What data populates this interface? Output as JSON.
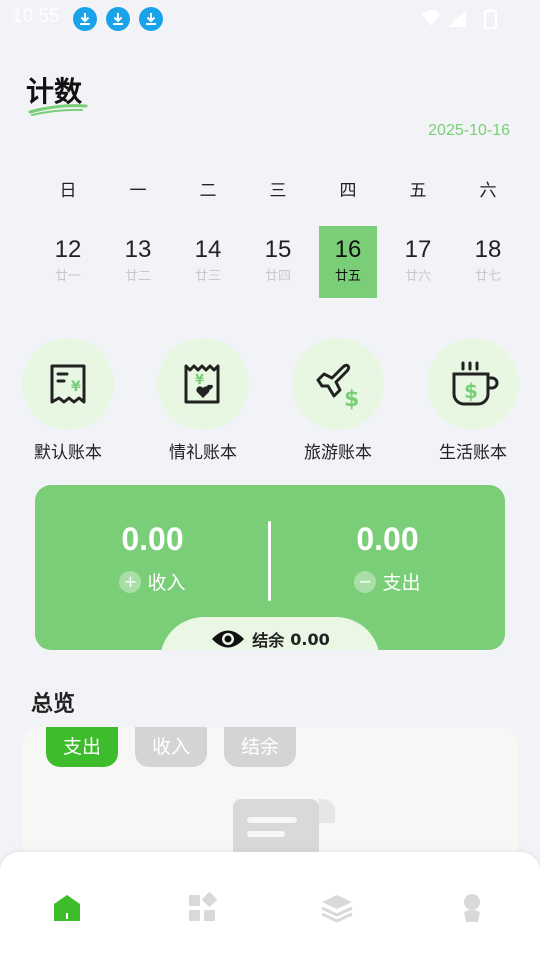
{
  "status_bar": {
    "time": "10:55",
    "notification_icons": [
      "download-icon",
      "download-icon",
      "download-icon"
    ],
    "system_icons": [
      "wifi-icon",
      "signal-icon",
      "battery-icon"
    ]
  },
  "header": {
    "title": "计数",
    "date": "2025-10-16"
  },
  "calendar": {
    "weekdays": [
      "日",
      "一",
      "二",
      "三",
      "四",
      "五",
      "六"
    ],
    "days": [
      {
        "num": "12",
        "lunar": "廿一"
      },
      {
        "num": "13",
        "lunar": "廿二"
      },
      {
        "num": "14",
        "lunar": "廿三"
      },
      {
        "num": "15",
        "lunar": "廿四"
      },
      {
        "num": "16",
        "lunar": "廿五"
      },
      {
        "num": "17",
        "lunar": "廿六"
      },
      {
        "num": "18",
        "lunar": "廿七"
      }
    ],
    "selected_index": 4
  },
  "books": [
    {
      "label": "默认账本",
      "icon": "receipt-yen-icon"
    },
    {
      "label": "情礼账本",
      "icon": "gift-receipt-icon"
    },
    {
      "label": "旅游账本",
      "icon": "plane-dollar-icon"
    },
    {
      "label": "生活账本",
      "icon": "coffee-dollar-icon"
    }
  ],
  "summary": {
    "income_value": "0.00",
    "income_label": "收入",
    "expense_value": "0.00",
    "expense_label": "支出",
    "balance_label": "结余",
    "balance_value": "0.00"
  },
  "overview": {
    "title": "总览",
    "tabs": [
      "支出",
      "收入",
      "结余"
    ],
    "active_tab": 0
  },
  "bottom_nav": {
    "items": [
      "home-icon",
      "grid-icon",
      "layers-icon",
      "profile-icon"
    ],
    "active_index": 0
  },
  "colors": {
    "accent": "#7bce78",
    "active_pill": "#3ebd2c",
    "book_circle": "#e8f7e2"
  }
}
